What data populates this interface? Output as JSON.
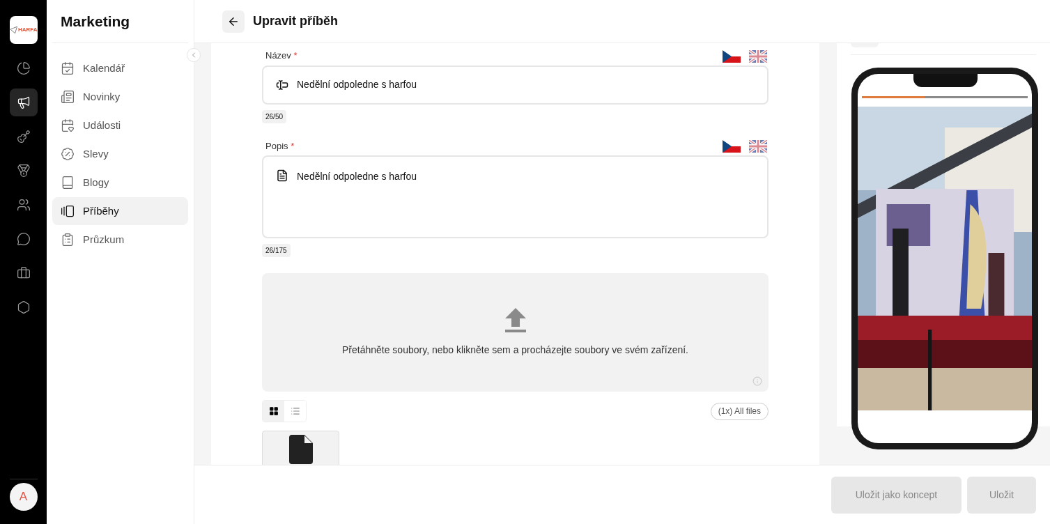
{
  "rail": {
    "logo_text": "HARFA",
    "items": [
      {
        "kind": "pie",
        "selected": false
      },
      {
        "kind": "megaphone",
        "selected": true
      },
      {
        "kind": "guitar",
        "selected": false
      },
      {
        "kind": "medal",
        "selected": false
      },
      {
        "kind": "users",
        "selected": false
      },
      {
        "kind": "chat",
        "selected": false
      },
      {
        "kind": "briefcase",
        "selected": false
      },
      {
        "kind": "settings",
        "selected": false
      }
    ],
    "avatar": "A"
  },
  "sidebar": {
    "title": "Marketing",
    "items": [
      {
        "label": "Kalendář",
        "kind": "calendar",
        "selected": false
      },
      {
        "label": "Novinky",
        "kind": "news",
        "selected": false
      },
      {
        "label": "Události",
        "kind": "event",
        "selected": false
      },
      {
        "label": "Slevy",
        "kind": "discount",
        "selected": false
      },
      {
        "label": "Blogy",
        "kind": "book",
        "selected": false
      },
      {
        "label": "Příběhy",
        "kind": "stories",
        "selected": true
      },
      {
        "label": "Průzkum",
        "kind": "survey",
        "selected": false
      }
    ]
  },
  "header": {
    "title": "Upravit příběh"
  },
  "form": {
    "fields": [
      {
        "label": "Název",
        "required_mark": "*",
        "value": "Nedělní odpoledne s harfou",
        "counter": "26/50",
        "kind": "title"
      },
      {
        "label": "Popis",
        "required_mark": "*",
        "value": "Nedělní odpoledne s harfou",
        "counter": "26/175",
        "kind": "description"
      }
    ],
    "upload": {
      "text": "Přetáhněte soubory, nebo klikněte sem a procházejte soubory ve svém zařízení."
    },
    "views": [
      {
        "kind": "grid",
        "selected": true
      },
      {
        "kind": "list",
        "selected": false
      }
    ],
    "all_files": "(1x) All files"
  },
  "preview": {
    "progress": {
      "level": 0.38
    }
  },
  "footer": {
    "buttons": [
      "Uložit jako koncept",
      "Uložit"
    ]
  }
}
